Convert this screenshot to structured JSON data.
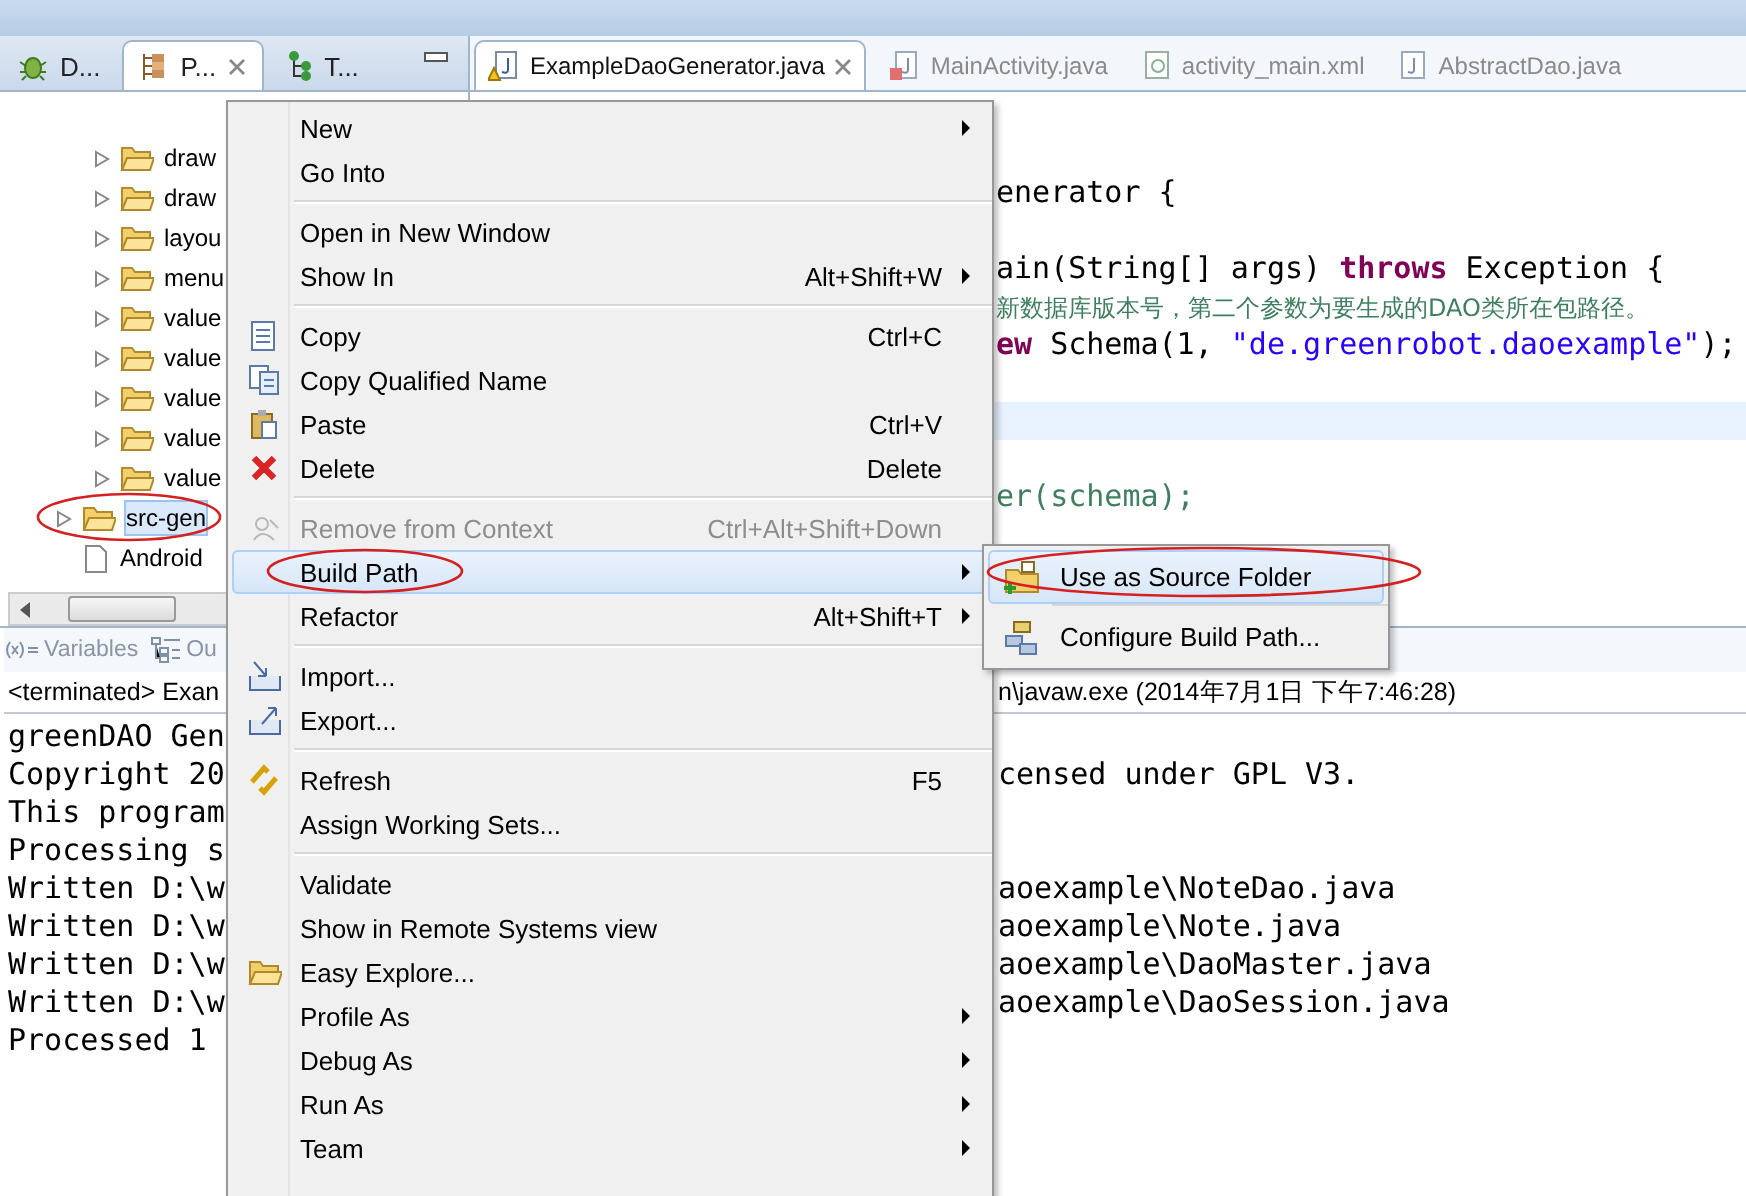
{
  "left_tabs": [
    {
      "label": "D...",
      "selected": false,
      "kind": "debug"
    },
    {
      "label": "P...",
      "selected": true,
      "kind": "package"
    },
    {
      "label": "T...",
      "selected": false,
      "kind": "hierarchy"
    }
  ],
  "tree": {
    "items": [
      {
        "children": [
          {
            "label": "draw",
            "kind": "folder",
            "expanded": false,
            "selected": false
          },
          {
            "label": "draw",
            "kind": "folder",
            "expanded": false,
            "selected": false
          },
          {
            "label": "layou",
            "kind": "folder",
            "expanded": false,
            "selected": false
          },
          {
            "label": "menu",
            "kind": "folder",
            "expanded": false,
            "selected": false
          },
          {
            "label": "value",
            "kind": "folder",
            "expanded": false,
            "selected": false
          },
          {
            "label": "value",
            "kind": "folder",
            "expanded": false,
            "selected": false
          },
          {
            "label": "value",
            "kind": "folder",
            "expanded": false,
            "selected": false
          },
          {
            "label": "value",
            "kind": "folder",
            "expanded": false,
            "selected": false
          },
          {
            "label": "value",
            "kind": "folder",
            "expanded": false,
            "selected": false
          }
        ]
      },
      {
        "label": "src-gen",
        "kind": "folder",
        "expanded": false,
        "selected": true
      },
      {
        "label": "Android",
        "kind": "file",
        "selected": false
      }
    ]
  },
  "editor_tabs": [
    {
      "label": "ExampleDaoGenerator.java",
      "selected": true,
      "kind": "java-warning"
    },
    {
      "label": "MainActivity.java",
      "selected": false,
      "kind": "java-error"
    },
    {
      "label": "activity_main.xml",
      "selected": false,
      "kind": "xml"
    },
    {
      "label": "AbstractDao.java",
      "selected": false,
      "kind": "java"
    }
  ],
  "code_lines": [
    {
      "current": false,
      "segments": [
        {
          "text": "enerator {",
          "kind": "plain"
        }
      ]
    },
    {
      "current": false
    },
    {
      "current": false,
      "segments": [
        {
          "text": "ain(String[] args) ",
          "kind": "plain"
        },
        {
          "text": "throws",
          "kind": "keyword"
        },
        {
          "text": " Exception {",
          "kind": "plain"
        }
      ]
    },
    {
      "current": false,
      "segments": [
        {
          "text": "新数据库版本号，第二个参数为要生成的DAO类所在包路径。",
          "kind": "comment"
        }
      ]
    },
    {
      "current": false,
      "segments": [
        {
          "text": "ew",
          "kind": "keyword"
        },
        {
          "text": " Schema(1, ",
          "kind": "plain"
        },
        {
          "text": "\"de.greenrobot.daoexample\"",
          "kind": "string"
        },
        {
          "text": ");",
          "kind": "plain"
        }
      ]
    },
    {
      "current": false
    },
    {
      "current": true
    },
    {
      "current": false
    },
    {
      "current": false,
      "segments": [
        {
          "text": "er(schema);",
          "kind": "comment"
        }
      ]
    }
  ],
  "bottom_tabs": [
    {
      "label": "Variables",
      "kind": "variables",
      "selected": false
    },
    {
      "label": "Ou",
      "kind": "outline",
      "selected": false
    }
  ],
  "console": {
    "header_left": "<terminated> Exan",
    "header_right": "n\\javaw.exe (2014年7月1日 下午7:46:28)",
    "lines": [
      {
        "left": "greenDAO Gen"
      },
      {
        "left": "Copyright 20",
        "right": "censed under GPL V3."
      },
      {
        "left": "This program"
      },
      {
        "left": "Processing s"
      },
      {
        "left": "Written D:\\w",
        "right": "aoexample\\NoteDao.java"
      },
      {
        "left": "Written D:\\w",
        "right": "aoexample\\Note.java"
      },
      {
        "left": "Written D:\\w",
        "right": "aoexample\\DaoMaster.java"
      },
      {
        "left": "Written D:\\w",
        "right": "aoexample\\DaoSession.java"
      },
      {
        "left": "Processed 1"
      }
    ]
  },
  "context_menu": {
    "items": [
      {
        "kind": "item",
        "label": "New",
        "submenu": true,
        "selected": false,
        "disabled": false
      },
      {
        "kind": "item",
        "label": "Go Into",
        "selected": false,
        "disabled": false
      },
      {
        "kind": "separator"
      },
      {
        "kind": "item",
        "label": "Open in New Window",
        "selected": false,
        "disabled": false
      },
      {
        "kind": "item",
        "label": "Show In",
        "shortcut": "Alt+Shift+W",
        "submenu": true,
        "selected": false,
        "disabled": false
      },
      {
        "kind": "separator"
      },
      {
        "kind": "copy",
        "label": "Copy",
        "shortcut": "Ctrl+C",
        "selected": false,
        "disabled": false
      },
      {
        "kind": "copy-name",
        "label": "Copy Qualified Name",
        "selected": false,
        "disabled": false
      },
      {
        "kind": "paste",
        "label": "Paste",
        "shortcut": "Ctrl+V",
        "selected": false,
        "disabled": false
      },
      {
        "kind": "delete",
        "label": "Delete",
        "shortcut": "Delete",
        "selected": false,
        "disabled": false
      },
      {
        "kind": "separator"
      },
      {
        "kind": "remove",
        "label": "Remove from Context",
        "shortcut": "Ctrl+Alt+Shift+Down",
        "selected": false,
        "disabled": true
      },
      {
        "kind": "item",
        "label": "Build Path",
        "submenu": true,
        "selected": true,
        "disabled": false
      },
      {
        "kind": "item",
        "label": "Refactor",
        "shortcut": "Alt+Shift+T",
        "submenu": true,
        "selected": false,
        "disabled": false
      },
      {
        "kind": "separator"
      },
      {
        "kind": "import",
        "label": "Import...",
        "selected": false,
        "disabled": false
      },
      {
        "kind": "export",
        "label": "Export...",
        "selected": false,
        "disabled": false
      },
      {
        "kind": "separator"
      },
      {
        "kind": "refresh",
        "label": "Refresh",
        "shortcut": "F5",
        "selected": false,
        "disabled": false
      },
      {
        "kind": "item",
        "label": "Assign Working Sets...",
        "selected": false,
        "disabled": false
      },
      {
        "kind": "separator"
      },
      {
        "kind": "item",
        "label": "Validate",
        "selected": false,
        "disabled": false
      },
      {
        "kind": "item",
        "label": "Show in Remote Systems view",
        "selected": false,
        "disabled": false
      },
      {
        "kind": "folder",
        "label": "Easy Explore...",
        "selected": false,
        "disabled": false
      },
      {
        "kind": "item",
        "label": "Profile As",
        "submenu": true,
        "selected": false,
        "disabled": false
      },
      {
        "kind": "item",
        "label": "Debug As",
        "submenu": true,
        "selected": false,
        "disabled": false
      },
      {
        "kind": "item",
        "label": "Run As",
        "submenu": true,
        "selected": false,
        "disabled": false
      },
      {
        "kind": "item",
        "label": "Team",
        "submenu": true,
        "selected": false,
        "disabled": false
      }
    ]
  },
  "submenu": {
    "items": [
      {
        "kind": "source-folder",
        "label": "Use as Source Folder",
        "selected": true
      },
      {
        "kind": "build-path",
        "label": "Configure Build Path...",
        "selected": false
      }
    ]
  }
}
